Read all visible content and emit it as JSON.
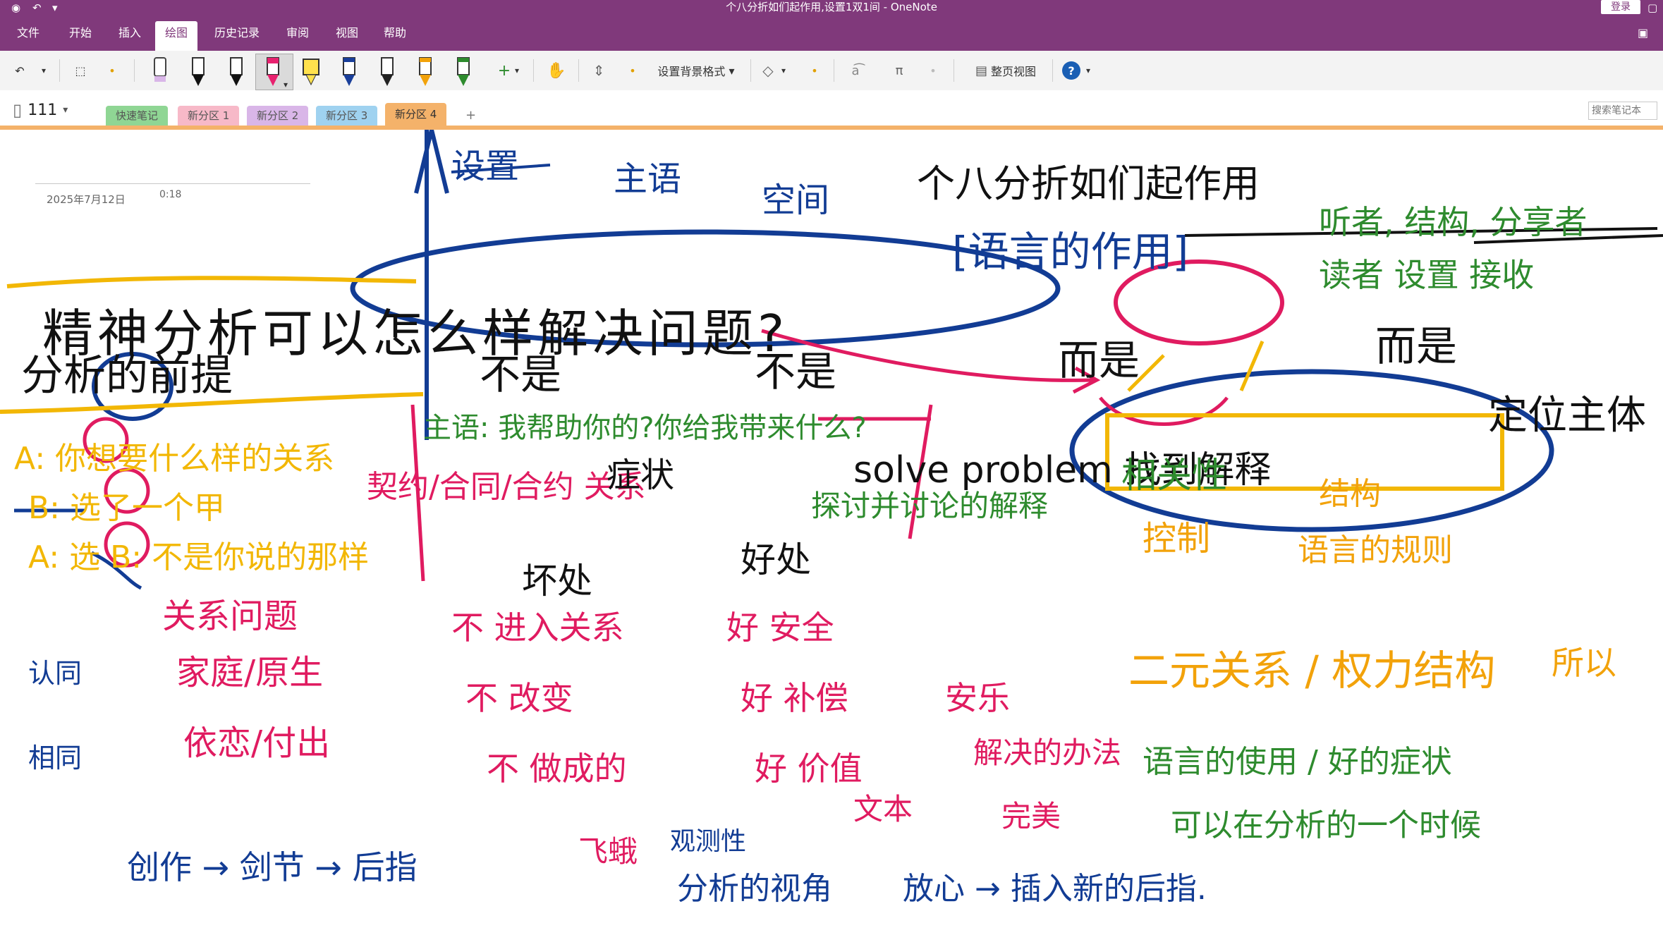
{
  "window": {
    "title": "个八分折如们起作用,设置1双1间 - OneNote",
    "login": "登录"
  },
  "menu": {
    "items": [
      "文件",
      "开始",
      "插入",
      "绘图",
      "历史记录",
      "审阅",
      "视图",
      "帮助"
    ],
    "active": "绘图"
  },
  "toolbar": {
    "background_format": "设置背景格式",
    "page_view": "整页视图"
  },
  "notebook": {
    "name": "111",
    "search_placeholder": "搜索笔记本"
  },
  "sections": [
    {
      "label": "快速笔记",
      "color": "#8fd694"
    },
    {
      "label": "新分区 1",
      "color": "#f7b9c8"
    },
    {
      "label": "新分区 2",
      "color": "#d9b6e8"
    },
    {
      "label": "新分区 3",
      "color": "#9fd2f0"
    },
    {
      "label": "新分区 4",
      "color": "#f4b26a"
    }
  ],
  "page": {
    "date": "2025年7月12日",
    "time": "0:18",
    "ink_text": {
      "headline": "精神分析可以怎么样解决问题?",
      "top_labels": [
        "设置",
        "主语",
        "空间"
      ],
      "function_title": "个八分折如们起作用",
      "language_role": "[语言的作用]",
      "listener_line1": "听者, 结构, 分享者",
      "listener_line2": "读者 设置 接收",
      "analysis_reason": "分析的前提",
      "is_not_1": "不是",
      "is_not_2": "不是",
      "rather_1": "而是",
      "rather_2": "而是",
      "position_rightmost": "定位主体",
      "subject_question": "主语: 我帮助你的?你给我带来什么?",
      "solve_problem": "solve problem 找到解释",
      "relation": "相关性",
      "contract": "契约/合同/合约 关系",
      "symptom": "症状",
      "interpretive": "探讨并讨论的解释",
      "structure": "结构",
      "language_law": "语言的规则",
      "control": "控制",
      "binary_power": "二元关系 / 权力结构",
      "right_edge": "所以",
      "hidden": "坏处",
      "good": "好处",
      "A_line": "A: 你想要什么样的关系",
      "B_line": "B: 选了一个甲",
      "A_line2": "A: 选 B: 不是你说的那样",
      "q1": "关系问题",
      "q2": "家庭/原生",
      "q3": "依恋/付出",
      "acknowledge": "认同",
      "recognize": "相同",
      "no1": "不 进入关系",
      "no2": "不 改变",
      "no3": "不 做成的",
      "good1": "好 安全",
      "good2": "好 补偿",
      "good3": "好 价值",
      "comfort": "安乐",
      "solve_solution": "解决的办法",
      "complete": "完美",
      "text_meaning": "文本",
      "language_use": "语言的使用 / 好的症状",
      "bottom_chain": "创作 → 剑节 → 后指",
      "bottom_mid": "飞蛾",
      "observe": "观测性",
      "analysis_view": "分析的视角",
      "bottom_right": "放心 → 插入新的后指.",
      "green_bottom": "可以在分析的一个时候"
    }
  }
}
